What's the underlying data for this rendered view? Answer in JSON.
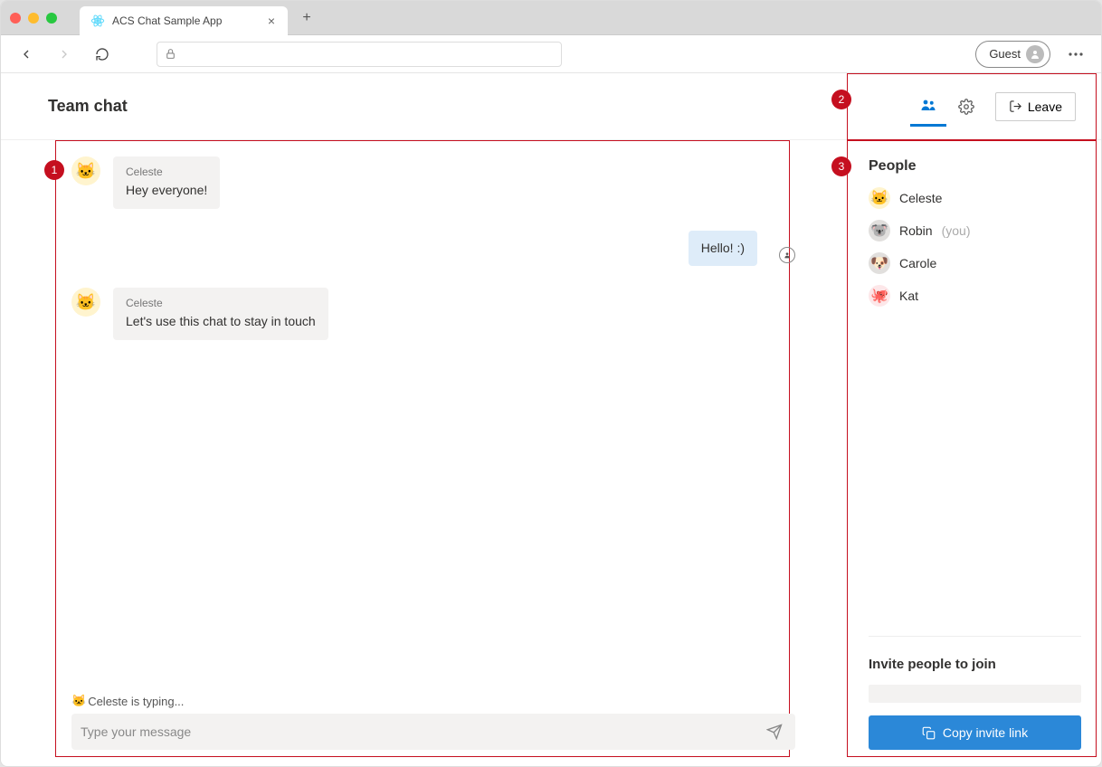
{
  "browser": {
    "tab_title": "ACS Chat Sample App",
    "guest_label": "Guest"
  },
  "header": {
    "title": "Team chat",
    "leave_label": "Leave"
  },
  "messages": [
    {
      "sender": "Celeste",
      "text": "Hey everyone!",
      "mine": false,
      "avatar": "🐱"
    },
    {
      "sender": "",
      "text": "Hello! :)",
      "mine": true
    },
    {
      "sender": "Celeste",
      "text": "Let's use this chat to stay in touch",
      "mine": false,
      "avatar": "🐱"
    }
  ],
  "typing": {
    "avatar": "🐱",
    "text": "Celeste is typing..."
  },
  "compose": {
    "placeholder": "Type your message"
  },
  "sidebar": {
    "people_label": "People",
    "people": [
      {
        "name": "Celeste",
        "avatar": "🐱",
        "bg": "#fff4ce"
      },
      {
        "name": "Robin",
        "avatar": "🐨",
        "bg": "#e1dfdd",
        "you": true,
        "you_label": "(you)"
      },
      {
        "name": "Carole",
        "avatar": "🐶",
        "bg": "#e1dfdd"
      },
      {
        "name": "Kat",
        "avatar": "🐙",
        "bg": "#fde7e9"
      }
    ],
    "invite_title": "Invite people to join",
    "copy_label": "Copy invite link"
  },
  "annotations": {
    "a1": "1",
    "a2": "2",
    "a3": "3"
  }
}
